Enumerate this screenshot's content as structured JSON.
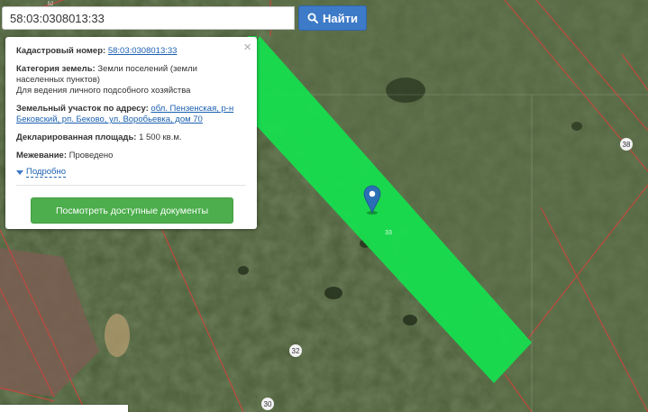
{
  "search": {
    "value": "58:03:0308013:33",
    "button_label": "Найти"
  },
  "popup": {
    "cadastral_label": "Кадастровый номер:",
    "cadastral_value": "58:03:0308013:33",
    "category_label": "Категория земель:",
    "category_value": "Земли поселений (земли населенных пунктов)",
    "purpose": "Для ведения личного подсобного хозяйства",
    "address_label": "Земельный участок по адресу:",
    "address_value": "обл. Пензенская, р-н Бековский, рп. Беково, ул. Воробьевка, дом 70",
    "area_label": "Декларированная площадь:",
    "area_value": "1 500 кв.м.",
    "survey_label": "Межевание:",
    "survey_value": "Проведено",
    "more_label": "Подробно",
    "docs_button": "Посмотреть доступные документы"
  },
  "map": {
    "parcel_label": "33",
    "label_38": "38",
    "label_32": "32",
    "label_30": "30",
    "label_52": "52",
    "colors": {
      "parcel_fill": "#16e04f",
      "boundary": "#c9463e",
      "marker": "#2b6fb5"
    }
  }
}
